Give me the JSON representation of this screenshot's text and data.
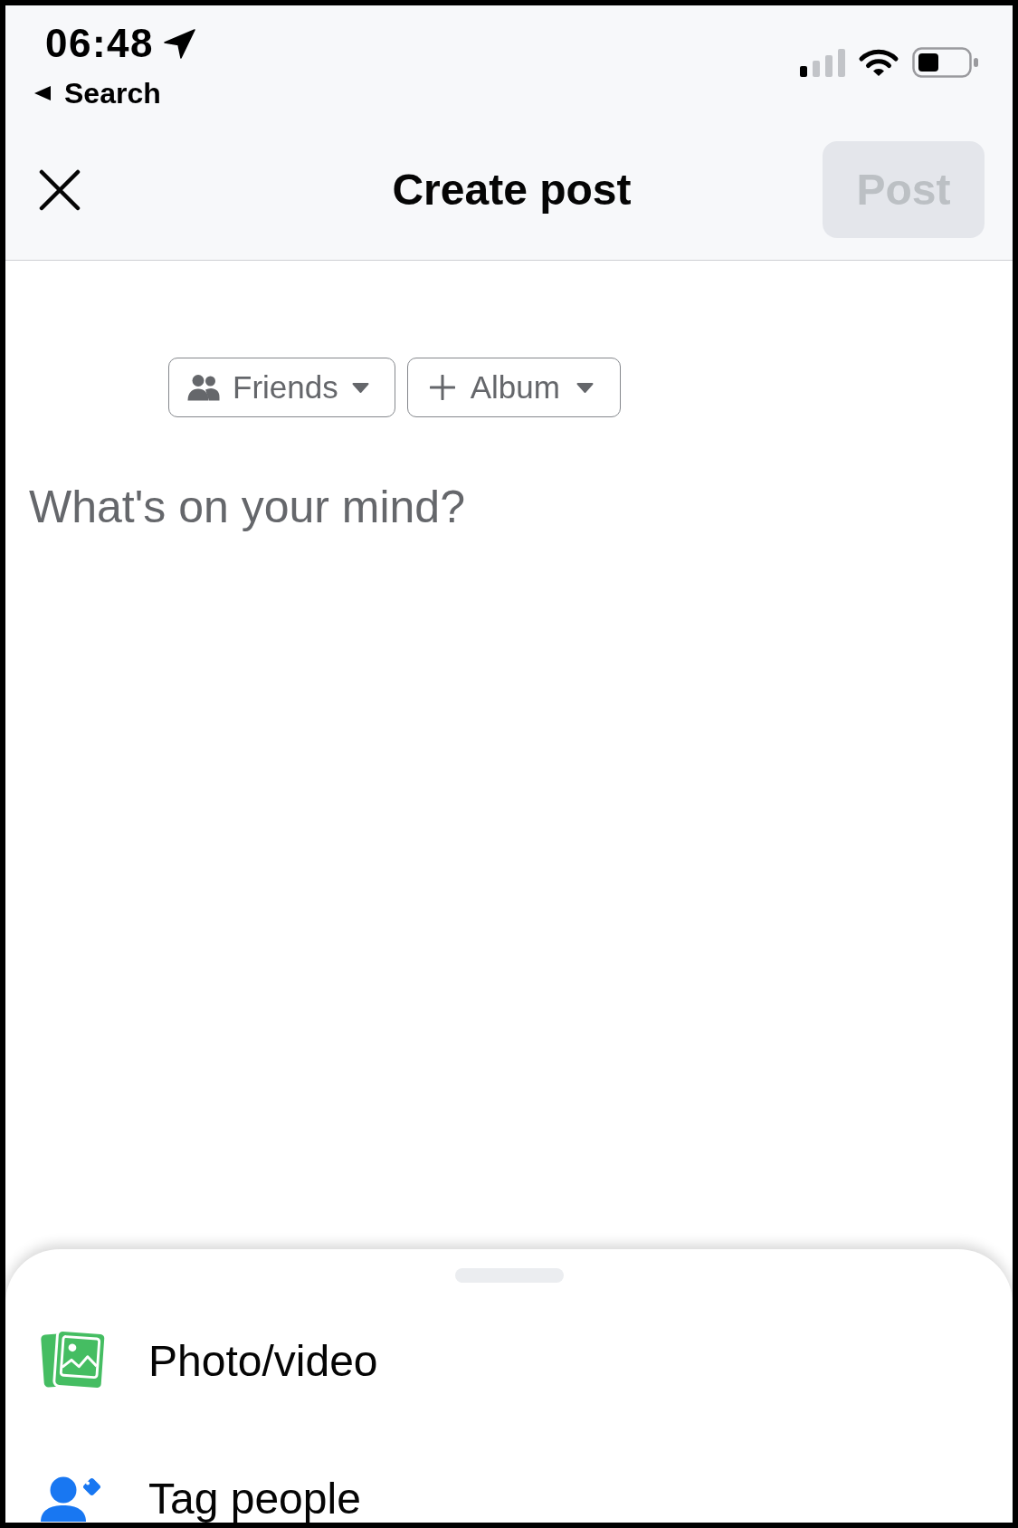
{
  "status_bar": {
    "time": "06:48",
    "back_label": "Search"
  },
  "header": {
    "title": "Create post",
    "post_button": {
      "label": "Post",
      "disabled": true
    }
  },
  "audience_buttons": [
    {
      "kind": "audience",
      "label": "Friends"
    },
    {
      "kind": "album",
      "label": "Album"
    }
  ],
  "composer": {
    "placeholder": "What's on your mind?"
  },
  "sheet": {
    "items": [
      {
        "kind": "photo",
        "label": "Photo/video"
      },
      {
        "kind": "tag",
        "label": "Tag people"
      }
    ]
  }
}
